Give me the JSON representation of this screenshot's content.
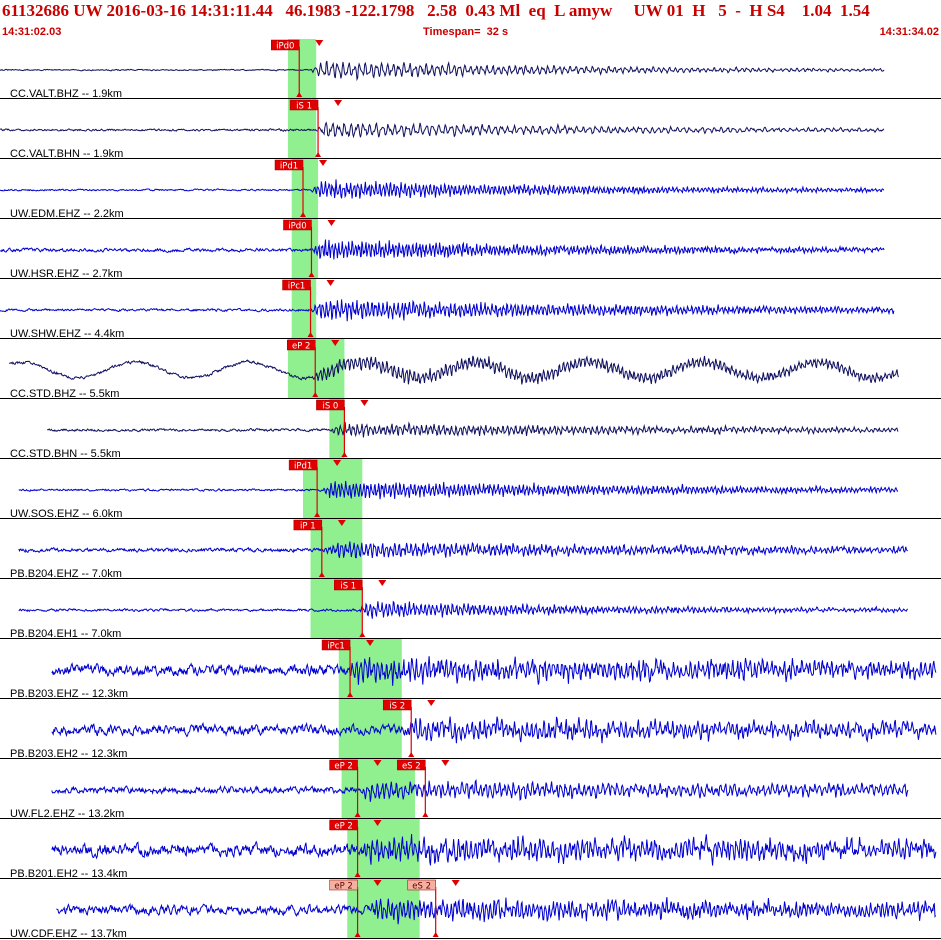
{
  "header": {
    "event_line": "61132686 UW 2016-03-16 14:31:11.44   46.1983 -122.1798   2.58  0.43 Ml  eq  L amyw     UW 01  H   5  -  H S4    1.04  1.54",
    "start_time": "14:31:02.03",
    "timespan": "Timespan=  32 s",
    "end_time": "14:31:34.02"
  },
  "colors": {
    "title": "#c80000",
    "pick_box": "#e00000",
    "pick_box_final": "#f4b0a0",
    "pick_line": "#e00000",
    "window": "#90f090",
    "trace_short_period": "#0000d0",
    "trace_broadband": "#101060",
    "divider": "#000000"
  },
  "chart_data": {
    "type": "line",
    "title": "61132686 UW 2016-03-16 14:31:11.44",
    "time_range": [
      "14:31:02.03",
      "14:31:34.02"
    ],
    "timespan_s": 32,
    "traces": [
      {
        "label": "CC.VALT.BHZ -- 1.9km",
        "dist_km": 1.9,
        "style": "broadband",
        "start": 0.0,
        "end": 0.94,
        "amp": 0.45,
        "noise": 0.03,
        "onset": 0.33,
        "decay": 3.5,
        "freq": 170,
        "window": [
          0.306,
          0.336
        ],
        "picks": [
          {
            "label": "iPd0",
            "t": 0.318,
            "final": false
          }
        ]
      },
      {
        "label": "CC.VALT.BHN -- 1.9km",
        "dist_km": 1.9,
        "style": "broadband",
        "start": 0.0,
        "end": 0.94,
        "amp": 0.38,
        "noise": 0.05,
        "onset": 0.335,
        "decay": 3.0,
        "freq": 150,
        "window": [
          0.306,
          0.336
        ],
        "picks": [
          {
            "label": "iS 1",
            "t": 0.338,
            "final": false
          }
        ]
      },
      {
        "label": "UW.EDM.EHZ -- 2.2km",
        "dist_km": 2.2,
        "style": "short",
        "start": 0.0,
        "end": 0.94,
        "amp": 0.45,
        "noise": 0.04,
        "onset": 0.33,
        "decay": 3.0,
        "freq": 260,
        "window": [
          0.31,
          0.338
        ],
        "picks": [
          {
            "label": "iPd1",
            "t": 0.322,
            "final": false
          }
        ]
      },
      {
        "label": "UW.HSR.EHZ -- 2.7km",
        "dist_km": 2.7,
        "style": "short",
        "start": 0.0,
        "end": 0.94,
        "amp": 0.48,
        "noise": 0.08,
        "onset": 0.33,
        "decay": 3.0,
        "freq": 280,
        "window": [
          0.31,
          0.338
        ],
        "picks": [
          {
            "label": "iPd0",
            "t": 0.331,
            "final": false
          }
        ]
      },
      {
        "label": "UW.SHW.EHZ -- 4.4km",
        "dist_km": 4.4,
        "style": "short",
        "start": 0.0,
        "end": 0.95,
        "amp": 0.48,
        "noise": 0.06,
        "onset": 0.33,
        "decay": 2.2,
        "freq": 250,
        "window": [
          0.31,
          0.336
        ],
        "picks": [
          {
            "label": "iPc1",
            "t": 0.33,
            "final": false
          }
        ]
      },
      {
        "label": "CC.STD.BHZ -- 5.5km",
        "dist_km": 5.5,
        "style": "broadband",
        "start": 0.01,
        "end": 0.955,
        "amp": 0.35,
        "noise": 0.08,
        "onset": 0.33,
        "decay": 1.0,
        "freq": 240,
        "swell": 0.38,
        "window": [
          0.306,
          0.366
        ],
        "picks": [
          {
            "label": "eP 2",
            "t": 0.335,
            "final": false
          }
        ]
      },
      {
        "label": "CC.STD.BHN -- 5.5km",
        "dist_km": 5.5,
        "style": "broadband",
        "start": 0.05,
        "end": 0.955,
        "amp": 0.32,
        "noise": 0.06,
        "onset": 0.35,
        "decay": 2.0,
        "freq": 220,
        "window": [
          0.35,
          0.366
        ],
        "picks": [
          {
            "label": "iS 0",
            "t": 0.366,
            "final": false
          }
        ]
      },
      {
        "label": "UW.SOS.EHZ -- 6.0km",
        "dist_km": 6.0,
        "style": "short",
        "start": 0.02,
        "end": 0.955,
        "amp": 0.42,
        "noise": 0.05,
        "onset": 0.342,
        "decay": 2.2,
        "freq": 260,
        "window": [
          0.322,
          0.385
        ],
        "picks": [
          {
            "label": "iPd1",
            "t": 0.337,
            "final": false
          }
        ]
      },
      {
        "label": "PB.B204.EHZ -- 7.0km",
        "dist_km": 7.0,
        "style": "short",
        "start": 0.02,
        "end": 0.965,
        "amp": 0.36,
        "noise": 0.09,
        "onset": 0.345,
        "decay": 1.8,
        "freq": 230,
        "window": [
          0.33,
          0.385
        ],
        "picks": [
          {
            "label": "iP 1",
            "t": 0.342,
            "final": false
          }
        ]
      },
      {
        "label": "PB.B204.EH1 -- 7.0km",
        "dist_km": 7.0,
        "style": "short",
        "start": 0.02,
        "end": 0.965,
        "amp": 0.4,
        "noise": 0.06,
        "onset": 0.38,
        "decay": 3.2,
        "freq": 240,
        "window": [
          0.33,
          0.385
        ],
        "picks": [
          {
            "label": "iS 1",
            "t": 0.385,
            "final": false
          }
        ]
      },
      {
        "label": "PB.B203.EHZ -- 12.3km",
        "dist_km": 12.3,
        "style": "short",
        "start": 0.055,
        "end": 0.995,
        "amp": 0.5,
        "noise": 0.26,
        "onset": 0.37,
        "decay": 0.9,
        "freq": 220,
        "window": [
          0.36,
          0.427
        ],
        "picks": [
          {
            "label": "iPc1",
            "t": 0.372,
            "final": false
          }
        ]
      },
      {
        "label": "PB.B203.EH2 -- 12.3km",
        "dist_km": 12.3,
        "style": "short",
        "start": 0.055,
        "end": 0.995,
        "amp": 0.45,
        "noise": 0.24,
        "onset": 0.43,
        "decay": 1.2,
        "freq": 220,
        "window": [
          0.36,
          0.427
        ],
        "picks": [
          {
            "label": "iS 2",
            "t": 0.437,
            "final": false
          }
        ]
      },
      {
        "label": "UW.FL2.EHZ -- 13.2km",
        "dist_km": 13.2,
        "style": "short",
        "start": 0.055,
        "end": 0.965,
        "amp": 0.4,
        "noise": 0.16,
        "onset": 0.38,
        "decay": 1.2,
        "freq": 200,
        "window": [
          0.363,
          0.441
        ],
        "picks": [
          {
            "label": "eP 2",
            "t": 0.38,
            "final": false
          },
          {
            "label": "eS 2",
            "t": 0.452,
            "final": false
          }
        ]
      },
      {
        "label": "PB.B201.EH2 -- 13.4km",
        "dist_km": 13.4,
        "style": "short",
        "start": 0.055,
        "end": 0.995,
        "amp": 0.5,
        "noise": 0.3,
        "onset": 0.38,
        "decay": 0.8,
        "freq": 220,
        "window": [
          0.369,
          0.446
        ],
        "picks": [
          {
            "label": "eP 2",
            "t": 0.38,
            "final": false
          }
        ]
      },
      {
        "label": "UW.CDF.EHZ -- 13.7km",
        "dist_km": 13.7,
        "style": "short",
        "start": 0.06,
        "end": 0.995,
        "amp": 0.45,
        "noise": 0.22,
        "onset": 0.39,
        "decay": 0.9,
        "freq": 240,
        "window": [
          0.369,
          0.446
        ],
        "picks": [
          {
            "label": "eP 2",
            "t": 0.38,
            "final": true
          },
          {
            "label": "eS 2",
            "t": 0.463,
            "final": true
          }
        ]
      }
    ]
  }
}
